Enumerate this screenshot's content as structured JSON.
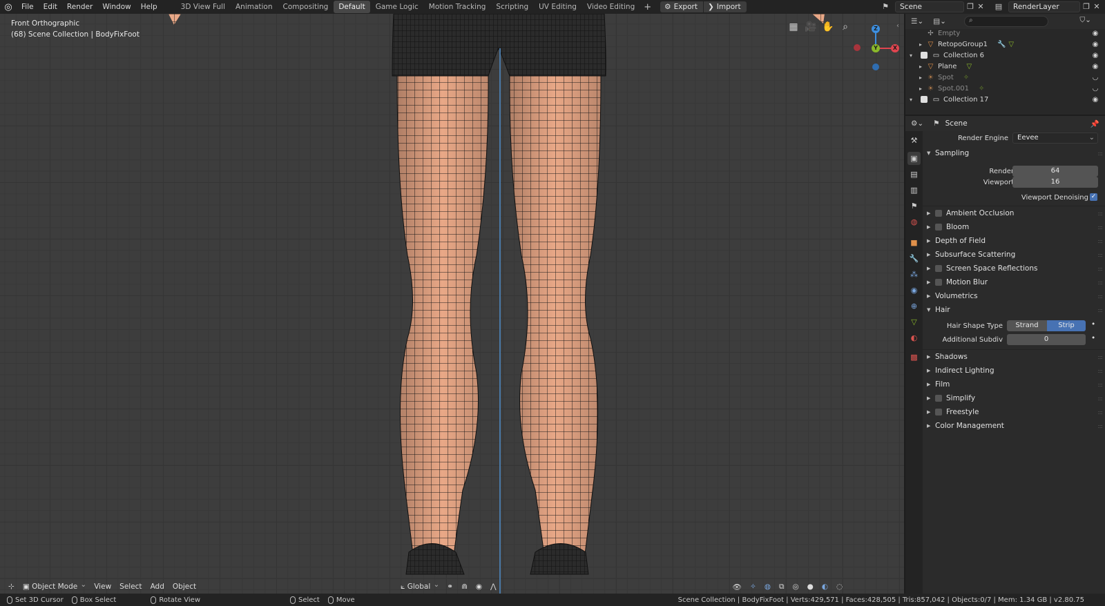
{
  "menu": {
    "items": [
      "File",
      "Edit",
      "Render",
      "Window",
      "Help"
    ]
  },
  "workspaces": {
    "tabs": [
      "3D View Full",
      "Animation",
      "Compositing",
      "Default",
      "Game Logic",
      "Motion Tracking",
      "Scripting",
      "UV Editing",
      "Video Editing"
    ],
    "active": "Default",
    "add": "+"
  },
  "toolbar": {
    "export_label": "Export",
    "import_label": "Import"
  },
  "scene": {
    "name": "Scene"
  },
  "view_layer": {
    "name": "RenderLayer"
  },
  "viewport": {
    "view_name": "Front Orthographic",
    "collection_info": "(68) Scene Collection | BodyFixFoot",
    "mode": "Object Mode",
    "menus": [
      "View",
      "Select",
      "Add",
      "Object"
    ],
    "transform_orientation": "Global",
    "gizmo": {
      "z": "Z",
      "y": "Y",
      "x": "X"
    }
  },
  "outliner": {
    "rows": [
      {
        "name": "Empty",
        "dim": true
      },
      {
        "name": "RetopoGroup1",
        "dim": false
      },
      {
        "name": "Collection 6",
        "dim": false
      },
      {
        "name": "Plane",
        "dim": false
      },
      {
        "name": "Spot",
        "dim": true
      },
      {
        "name": "Spot.001",
        "dim": true
      },
      {
        "name": "Collection 17",
        "dim": false
      }
    ]
  },
  "properties": {
    "context": "Scene",
    "render_engine_label": "Render Engine",
    "render_engine": "Eevee",
    "sampling": {
      "title": "Sampling",
      "render_label": "Render",
      "render": "64",
      "viewport_label": "Viewport",
      "viewport": "16",
      "denoise_label": "Viewport Denoising",
      "denoise_check": "✓"
    },
    "panels_a": [
      {
        "title": "Ambient Occlusion",
        "checkbox": true
      },
      {
        "title": "Bloom",
        "checkbox": true
      },
      {
        "title": "Depth of Field",
        "checkbox": false
      },
      {
        "title": "Subsurface Scattering",
        "checkbox": false
      },
      {
        "title": "Screen Space Reflections",
        "checkbox": true
      },
      {
        "title": "Motion Blur",
        "checkbox": true
      },
      {
        "title": "Volumetrics",
        "checkbox": false
      }
    ],
    "hair": {
      "title": "Hair",
      "shape_label": "Hair Shape Type",
      "strand": "Strand",
      "strip": "Strip",
      "subdiv_label": "Additional Subdiv",
      "subdiv": "0"
    },
    "panels_b": [
      {
        "title": "Shadows",
        "checkbox": false
      },
      {
        "title": "Indirect Lighting",
        "checkbox": false
      },
      {
        "title": "Film",
        "checkbox": false
      },
      {
        "title": "Simplify",
        "checkbox": true
      },
      {
        "title": "Freestyle",
        "checkbox": true
      },
      {
        "title": "Color Management",
        "checkbox": false
      }
    ]
  },
  "statusbar": {
    "set_cursor": "Set 3D Cursor",
    "box_select": "Box Select",
    "rotate_view": "Rotate View",
    "select": "Select",
    "move": "Move",
    "stats": "Scene Collection | BodyFixFoot | Verts:429,571 | Faces:428,505 | Tris:857,042 | Objects:0/7 | Mem: 1.34 GB | v2.80.75"
  },
  "colors": {
    "accent": "#4772b3",
    "skin": "#e9a887",
    "wire": "#1b1b1b",
    "axis_x": "#e0454f",
    "axis_y": "#8ab82a",
    "axis_z": "#3d8fe0"
  }
}
